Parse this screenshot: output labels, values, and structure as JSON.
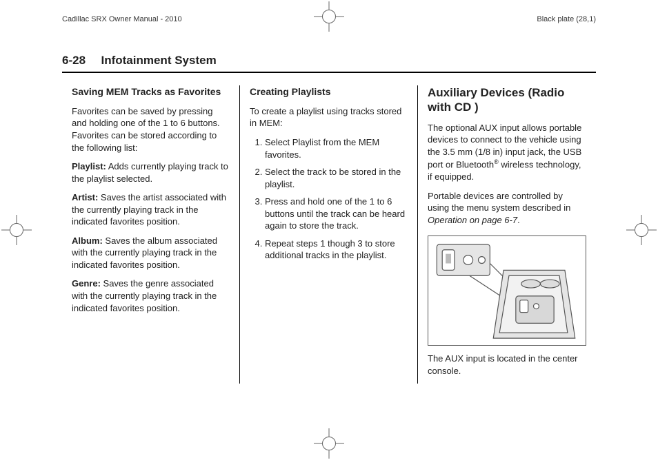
{
  "header": {
    "left": "Cadillac SRX Owner Manual - 2010",
    "right": "Black plate (28,1)"
  },
  "page": {
    "number": "6-28",
    "section": "Infotainment System"
  },
  "col1": {
    "heading": "Saving MEM Tracks as Favorites",
    "intro": "Favorites can be saved by pressing and holding one of the 1 to 6 buttons. Favorites can be stored according to the following list:",
    "items": [
      {
        "label": "Playlist:",
        "text": "Adds currently playing track to the playlist selected."
      },
      {
        "label": "Artist:",
        "text": "Saves the artist associated with the currently playing track in the indicated favorites position."
      },
      {
        "label": "Album:",
        "text": "Saves the album associated with the currently playing track in the indicated favorites position."
      },
      {
        "label": "Genre:",
        "text": "Saves the genre associated with the currently playing track in the indicated favorites position."
      }
    ]
  },
  "col2": {
    "heading": "Creating Playlists",
    "intro": "To create a playlist using tracks stored in MEM:",
    "steps": [
      "Select Playlist from the MEM favorites.",
      "Select the track to be stored in the playlist.",
      "Press and hold one of the 1 to 6 buttons until the track can be heard again to store the track.",
      "Repeat steps 1 though 3 to store additional tracks in the playlist."
    ]
  },
  "col3": {
    "heading": "Auxiliary Devices (Radio with CD )",
    "p1a": "The optional AUX input allows portable devices to connect to the vehicle using the 3.5 mm (1/8 in) input jack, the USB port or Bluetooth",
    "p1b": " wireless technology, if equipped.",
    "reg": "®",
    "p2a": "Portable devices are controlled by using the menu system described in ",
    "p2b": "Operation on page 6-7",
    "p2c": ".",
    "caption": "The AUX input is located in the center console."
  }
}
